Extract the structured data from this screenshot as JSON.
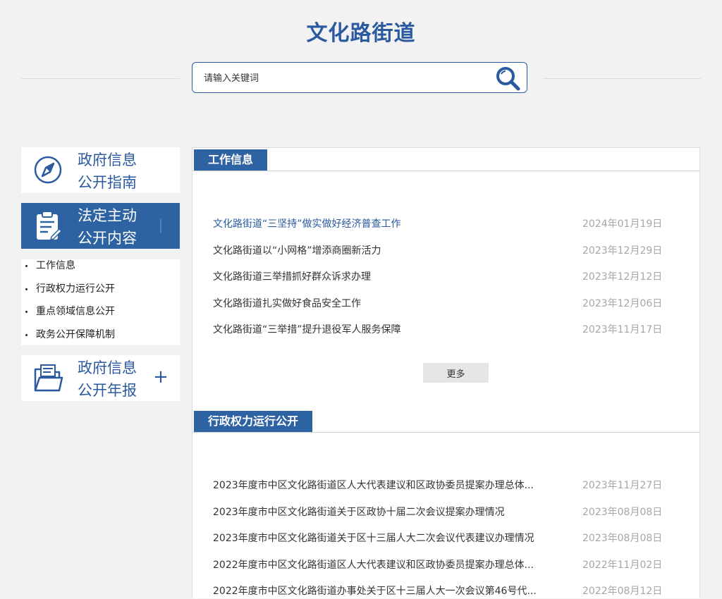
{
  "site": {
    "title": "文化路街道"
  },
  "search": {
    "placeholder": "请输入关键词"
  },
  "sidebar": {
    "cards": [
      {
        "line1": "政府信息",
        "line2": "公开指南",
        "icon": "compass-icon"
      },
      {
        "line1": "法定主动",
        "line2": "公开内容",
        "icon": "clipboard-icon",
        "toggle": "|"
      },
      {
        "line1": "政府信息",
        "line2": "公开年报",
        "icon": "folder-icon",
        "toggle": "+"
      }
    ],
    "sub_items": [
      "工作信息",
      "行政权力运行公开",
      "重点领域信息公开",
      "政务公开保障机制"
    ]
  },
  "sections": [
    {
      "title": "工作信息",
      "rows": [
        {
          "title": "文化路街道“三坚持”做实做好经济普查工作",
          "date": "2024年01月19日"
        },
        {
          "title": "文化路街道以“小网格”增添商圈新活力",
          "date": "2023年12月29日"
        },
        {
          "title": "文化路街道三举措抓好群众诉求办理",
          "date": "2023年12月12日"
        },
        {
          "title": "文化路街道扎实做好食品安全工作",
          "date": "2023年12月06日"
        },
        {
          "title": "文化路街道“三举措”提升退役军人服务保障",
          "date": "2023年11月17日"
        }
      ],
      "more": "更多"
    },
    {
      "title": "行政权力运行公开",
      "rows": [
        {
          "title": "2023年度市中区文化路街道区人大代表建议和区政协委员提案办理总体...",
          "date": "2023年11月27日"
        },
        {
          "title": "2023年度市中区文化路街道关于区政协十届二次会议提案办理情况",
          "date": "2023年08月08日"
        },
        {
          "title": "2023年度市中区文化路街道关于区十三届人大二次会议代表建议办理情况",
          "date": "2023年08月08日"
        },
        {
          "title": "2022年度市中区文化路街道区人大代表建议和区政协委员提案办理总体...",
          "date": "2022年11月02日"
        },
        {
          "title": "2022年度市中区文化路街道办事处关于区十三届人大一次会议第46号代...",
          "date": "2022年08月12日"
        }
      ]
    }
  ],
  "colors": {
    "accent": "#2d62a3",
    "title": "#2b5aa0",
    "date": "#a6a6a6",
    "background": "#f2f2f2"
  }
}
